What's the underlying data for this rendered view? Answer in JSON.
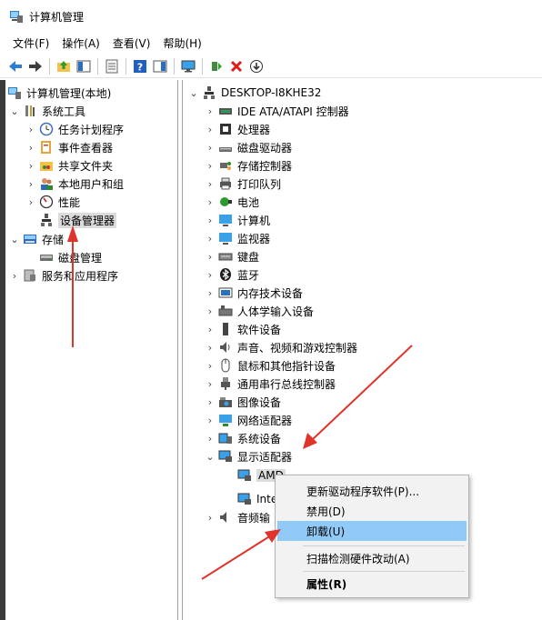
{
  "window": {
    "title": "计算机管理"
  },
  "menubar": [
    "文件(F)",
    "操作(A)",
    "查看(V)",
    "帮助(H)"
  ],
  "left_tree": {
    "root": "计算机管理(本地)",
    "system_tools": "系统工具",
    "items": [
      "任务计划程序",
      "事件查看器",
      "共享文件夹",
      "本地用户和组",
      "性能",
      "设备管理器"
    ],
    "storage": "存储",
    "disk_management": "磁盘管理",
    "services": "服务和应用程序"
  },
  "device_tree": {
    "computer": "DESKTOP-I8KHE32",
    "categories": [
      "IDE ATA/ATAPI 控制器",
      "处理器",
      "磁盘驱动器",
      "存储控制器",
      "打印队列",
      "电池",
      "计算机",
      "监视器",
      "键盘",
      "蓝牙",
      "内存技术设备",
      "人体学输入设备",
      "软件设备",
      "声音、视频和游戏控制器",
      "鼠标和其他指针设备",
      "通用串行总线控制器",
      "图像设备",
      "网络适配器",
      "系统设备",
      "显示适配器"
    ],
    "display_children": [
      "AMD",
      "Inte"
    ],
    "after_display": "音频输"
  },
  "context_menu": {
    "update": "更新驱动程序软件(P)...",
    "disable": "禁用(D)",
    "uninstall": "卸载(U)",
    "scan": "扫描检测硬件改动(A)",
    "properties": "属性(R)"
  },
  "colors": {
    "highlight": "#91c9f7",
    "arrow": "#e0332a",
    "selected_bg": "#dcdcdc"
  }
}
